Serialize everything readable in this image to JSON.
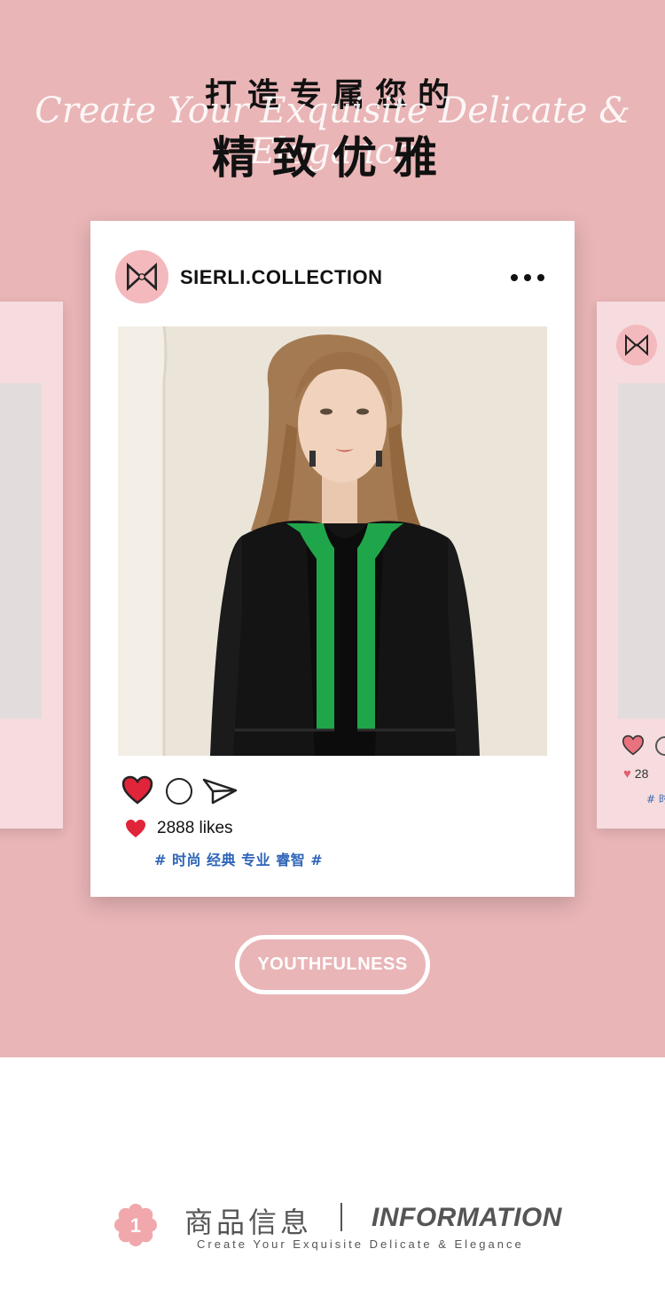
{
  "hero": {
    "heading_line1": "打造专属您的",
    "script_text": "Create Your Exquisite Delicate & Elegance",
    "heading_line2": "精致优雅"
  },
  "post": {
    "username": "SIERLI.COLLECTION",
    "likes_count": "2888",
    "likes_text": "2888 likes",
    "tags": "# 时尚 经典 专业 睿智 #"
  },
  "side_right": {
    "likes_partial": "28",
    "tag_partial": "# 时"
  },
  "pill_label": "YOUTHFULNESS",
  "info": {
    "number": "1",
    "title_cn": "商品信息",
    "title_en": "INFORMATION",
    "subtitle": "Create Your Exquisite Delicate & Elegance"
  },
  "colors": {
    "hero_bg": "#e9b5b7",
    "avatar_bg": "#f3b9bd",
    "heart": "#e0243a",
    "tag_blue": "#2e64b8",
    "jacket_trim": "#1fa64a"
  },
  "icons": [
    "logo-icon",
    "more-icon",
    "heart-icon",
    "comment-icon",
    "share-icon",
    "flower-icon"
  ]
}
